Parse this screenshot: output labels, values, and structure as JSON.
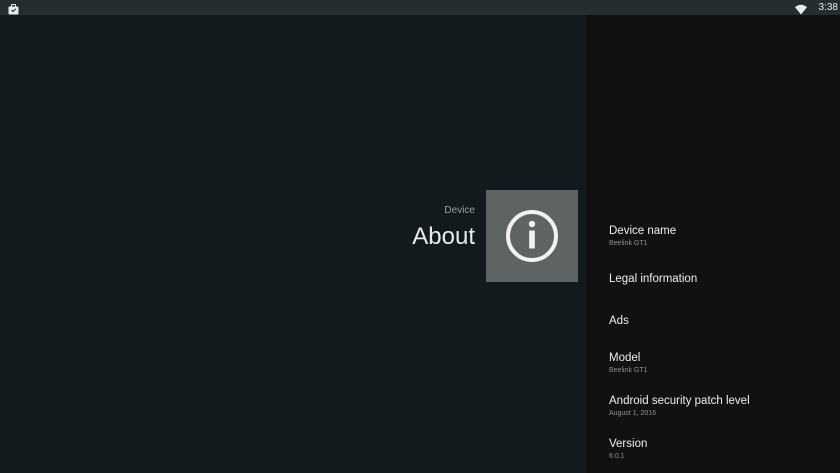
{
  "status_bar": {
    "time": "3:38",
    "left_icon": "briefcase-icon",
    "wifi_icon": "wifi-icon"
  },
  "guidance": {
    "breadcrumb": "Device",
    "title": "About",
    "icon": "info-icon"
  },
  "list": {
    "items": [
      {
        "title": "Device name",
        "summary": "Beelink GT1"
      },
      {
        "title": "Legal information",
        "summary": ""
      },
      {
        "title": "Ads",
        "summary": ""
      },
      {
        "title": "Model",
        "summary": "Beelink GT1"
      },
      {
        "title": "Android security patch level",
        "summary": "August 1, 2016"
      },
      {
        "title": "Version",
        "summary": "6.0.1"
      }
    ]
  },
  "colors": {
    "background": "#131a1d",
    "status_bar": "#262d31",
    "panel": "#111111",
    "icon_tile": "#5e6364"
  }
}
